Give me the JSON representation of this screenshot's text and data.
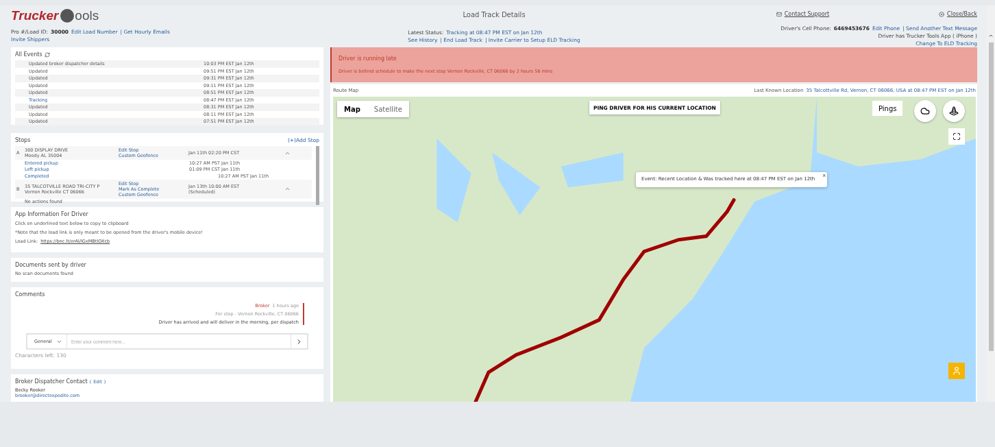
{
  "header": {
    "logo": {
      "word1": "Trucker",
      "word2": "ools"
    },
    "title": "Load Track Details",
    "contact_support": "Contact Support",
    "close_back": "Close/Back",
    "load_id_label": "Pro #/Load ID:",
    "load_id": "30000",
    "links": [
      "Edit Load Number",
      "| Get Hourly Emails"
    ],
    "invite_shippers": "Invite Shippers",
    "latest_status_label": "Latest Status:",
    "latest_status": "Tracking at 08:47 PM EST on Jan 12th",
    "status_links": [
      "See History",
      "| End Load Track",
      "| Invite Carrier to Setup ELD Tracking"
    ],
    "cell_label": "Driver's Cell Phone:",
    "cell_number": "6469453676",
    "cell_links": [
      "Edit Phone",
      "| Send Another Text Message"
    ],
    "app_note": "Driver has Trucker Tools App ( iPhone    )",
    "eld_link": "Change To ELD Tracking"
  },
  "events": {
    "title": "All Events",
    "rows": [
      {
        "label": "Updated broker dispatcher details",
        "time": "10:03 PM EST Jan 12th",
        "kind": "plain"
      },
      {
        "label": "Updated",
        "time": "09:51 PM EST Jan 12th",
        "kind": "plain"
      },
      {
        "label": "Updated",
        "time": "09:31 PM EST Jan 12th",
        "kind": "plain"
      },
      {
        "label": "Updated",
        "time": "09:11 PM EST Jan 12th",
        "kind": "plain"
      },
      {
        "label": "Updated",
        "time": "08:51 PM EST Jan 12th",
        "kind": "plain"
      },
      {
        "label": "Tracking",
        "time": "08:47 PM EST Jan 12th",
        "kind": "link"
      },
      {
        "label": "Updated",
        "time": "08:31 PM EST Jan 12th",
        "kind": "plain"
      },
      {
        "label": "Updated",
        "time": "08:11 PM EST Jan 12th",
        "kind": "plain"
      },
      {
        "label": "Updated",
        "time": "07:51 PM EST Jan 12th",
        "kind": "plain"
      }
    ]
  },
  "stops": {
    "title": "Stops",
    "add": "(+)Add Stop",
    "items": [
      {
        "letter": "A",
        "address": [
          "300 DISPLAY DRIVE",
          "Moody AL 35004"
        ],
        "links": [
          "Edit Stop",
          "Custom Geofence"
        ],
        "time": [
          "Jan 11th 02:20 PM CST"
        ],
        "actions": [
          {
            "label": "Entered pickup",
            "time": "10:27 AM PST Jan 11th",
            "kind": "near"
          },
          {
            "label": "Left pickup",
            "time": "01:09 PM CST Jan 11th",
            "kind": "near"
          },
          {
            "label": "Completed",
            "time": "10:27 AM PST Jan 11th",
            "kind": "far"
          }
        ]
      },
      {
        "letter": "B",
        "address": [
          "35 TALCOTVILLE ROAD TRI-CITY P",
          "Vernon Rockville CT 06066"
        ],
        "links": [
          "Edit Stop",
          "Mark As Complete",
          "Custom Geofence"
        ],
        "time": [
          "Jan 13th 10:00 AM EST",
          "(Scheduled)"
        ],
        "empty": "No actions found"
      }
    ]
  },
  "app_info": {
    "title": "App Information For Driver",
    "lines": [
      "Click on underlined text below to copy to clipboard",
      "*Note that the load link is only meant to be opened from the driver's mobile device!"
    ],
    "link_label": "Load Link:",
    "link": "https://bnc.lt/erAl/lGxMBtIOXcb"
  },
  "documents": {
    "title": "Documents sent by driver",
    "empty": "No scan documents found"
  },
  "comments": {
    "title": "Comments",
    "items": [
      {
        "author": "Broker",
        "ago": "1 hours ago",
        "stop": "For stop - Vernon Rockville, CT 06066",
        "text": "Driver has arrived and will deliver in the morning, per dispatch"
      }
    ],
    "category": "General",
    "placeholder": "Enter your comment here...",
    "chars_left": "Characters left: 130"
  },
  "broker": {
    "title": "Broker Dispatcher Contact",
    "edit_open": "(",
    "edit": "Edit",
    "edit_close": ")",
    "name": "Becky Rooker",
    "email": "brooker@directexpedite.com"
  },
  "alert": {
    "title": "Driver is running late",
    "message": "Driver is behind schedule to make the next stop Vernon Rockville, CT 06066 by 2 hours 56 mins"
  },
  "route_map": {
    "title": "Route Map",
    "last_known_label": "Last Known Location",
    "last_known": "35 Talcottville Rd, Vernon, CT 06066, USA at 08:47 PM EST on Jan 12th",
    "map_types": [
      {
        "label": "Map",
        "selected": true
      },
      {
        "label": "Satellite",
        "selected": false
      }
    ],
    "ping_button": "PING DRIVER FOR HIS CURRENT LOCATION",
    "pings": "Pings",
    "popup": "Event: Recent Location & Was tracked here at 08:47 PM EST on Jan 12th",
    "popup_close": "×"
  }
}
